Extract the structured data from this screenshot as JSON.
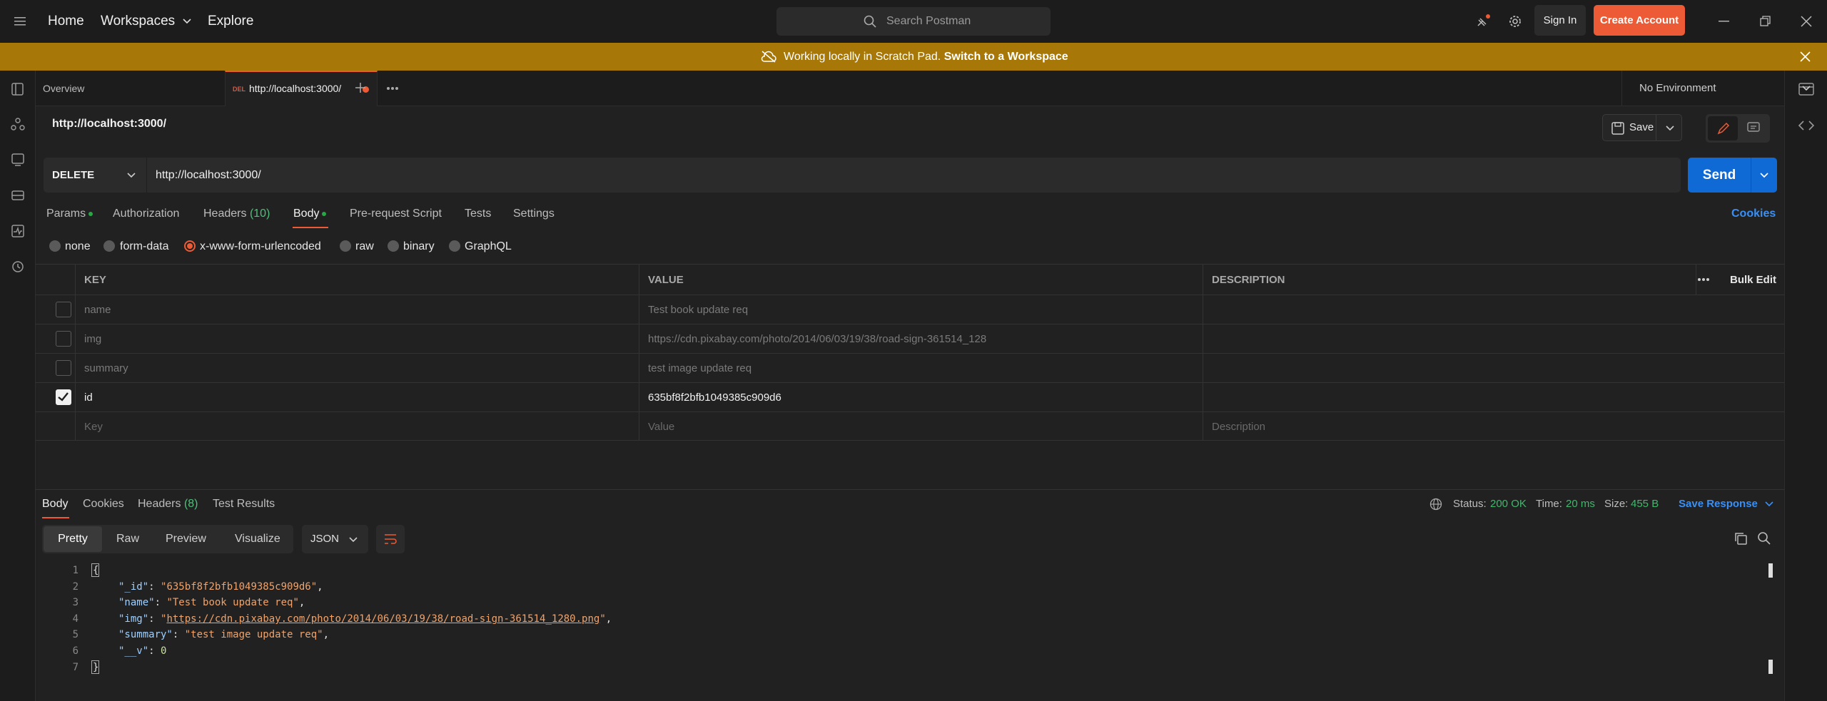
{
  "topbar": {
    "home": "Home",
    "workspaces": "Workspaces",
    "explore": "Explore",
    "search_placeholder": "Search Postman",
    "sign_in": "Sign In",
    "create_account": "Create Account"
  },
  "banner": {
    "text": "Working locally in Scratch Pad.",
    "link": "Switch to a Workspace"
  },
  "tabs": {
    "overview": "Overview",
    "active_method": "DEL",
    "active_url": "http://localhost:3000/",
    "environment": "No Environment"
  },
  "request": {
    "title": "http://localhost:3000/",
    "save": "Save",
    "method": "DELETE",
    "url": "http://localhost:3000/",
    "send": "Send"
  },
  "request_tabs": {
    "params": "Params",
    "authorization": "Authorization",
    "headers": "Headers",
    "headers_count": "(10)",
    "body": "Body",
    "prerequest": "Pre-request Script",
    "tests": "Tests",
    "settings": "Settings",
    "cookies": "Cookies"
  },
  "body_types": [
    "none",
    "form-data",
    "x-www-form-urlencoded",
    "raw",
    "binary",
    "GraphQL"
  ],
  "table": {
    "headers": {
      "key": "KEY",
      "value": "VALUE",
      "description": "DESCRIPTION",
      "bulk_edit": "Bulk Edit"
    },
    "rows": [
      {
        "key": "name",
        "value": "Test book update req",
        "checked": false
      },
      {
        "key": "img",
        "value": "https://cdn.pixabay.com/photo/2014/06/03/19/38/road-sign-361514_128",
        "checked": false
      },
      {
        "key": "summary",
        "value": "test image update req",
        "checked": false
      },
      {
        "key": "id",
        "value": "635bf8f2bfb1049385c909d6",
        "checked": true
      }
    ],
    "placeholder": {
      "key": "Key",
      "value": "Value",
      "description": "Description"
    }
  },
  "response": {
    "tabs": {
      "body": "Body",
      "cookies": "Cookies",
      "headers": "Headers",
      "headers_count": "(8)",
      "test_results": "Test Results"
    },
    "status_label": "Status:",
    "status_value": "200 OK",
    "time_label": "Time:",
    "time_value": "20 ms",
    "size_label": "Size:",
    "size_value": "455 B",
    "save_response": "Save Response",
    "views": [
      "Pretty",
      "Raw",
      "Preview",
      "Visualize"
    ],
    "format": "JSON",
    "code": {
      "line_numbers": [
        "1",
        "2",
        "3",
        "4",
        "5",
        "6",
        "7"
      ],
      "id_key": "\"_id\"",
      "id_val": "\"635bf8f2bfb1049385c909d6\"",
      "name_key": "\"name\"",
      "name_val": "\"Test book update req\"",
      "img_key": "\"img\"",
      "img_val": "https://cdn.pixabay.com/photo/2014/06/03/19/38/road-sign-361514_1280.png",
      "summary_key": "\"summary\"",
      "summary_val": "\"test image update req\"",
      "v_key": "\"__v\"",
      "v_val": "0"
    }
  },
  "colors": {
    "accent": "#ec5b35",
    "send_blue": "#0f6ad6",
    "banner": "#a77807",
    "link_blue": "#3a8ff5"
  }
}
